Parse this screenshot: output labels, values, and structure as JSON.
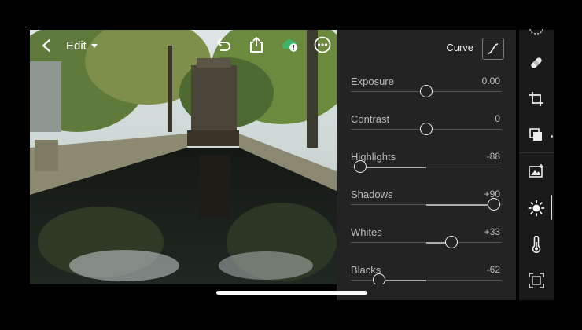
{
  "header": {
    "mode_label": "Edit",
    "icons": [
      "back-icon",
      "undo-icon",
      "share-icon",
      "cloud-sync-warning-icon",
      "more-icon"
    ]
  },
  "panel": {
    "curve_label": "Curve",
    "sliders": [
      {
        "name": "Exposure",
        "value": "0.00",
        "position": 0.5
      },
      {
        "name": "Contrast",
        "value": "0",
        "position": 0.5
      },
      {
        "name": "Highlights",
        "value": "-88",
        "position": 0.06
      },
      {
        "name": "Shadows",
        "value": "+90",
        "position": 0.95
      },
      {
        "name": "Whites",
        "value": "+33",
        "position": 0.665
      },
      {
        "name": "Blacks",
        "value": "-62",
        "position": 0.19
      }
    ]
  },
  "rail": {
    "icons": [
      "auto-icon",
      "healing-icon",
      "crop-icon",
      "presets-icon",
      "masking-icon",
      "light-icon",
      "color-temperature-icon",
      "vignette-icon"
    ],
    "active": "light-icon"
  },
  "colors": {
    "panel_bg": "#232323",
    "rail_bg": "#1a1a1a",
    "cloud_green": "#3db46d"
  }
}
